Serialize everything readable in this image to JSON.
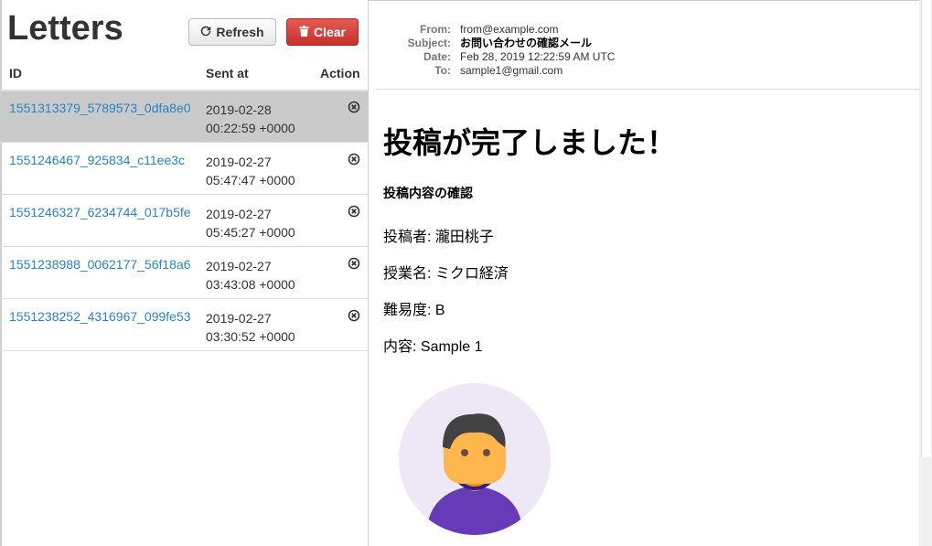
{
  "list": {
    "title": "Letters",
    "refresh_label": "Refresh",
    "clear_label": "Clear",
    "columns": [
      "ID",
      "Sent at",
      "Action"
    ],
    "rows": [
      {
        "id": "1551313379_5789573_0dfa8e0",
        "date": "2019-02-28",
        "time": "00:22:59 +0000",
        "selected": true
      },
      {
        "id": "1551246467_925834_c11ee3c",
        "date": "2019-02-27",
        "time": "05:47:47 +0000",
        "selected": false
      },
      {
        "id": "1551246327_6234744_017b5fe",
        "date": "2019-02-27",
        "time": "05:45:27 +0000",
        "selected": false
      },
      {
        "id": "1551238988_0062177_56f18a6",
        "date": "2019-02-27",
        "time": "03:43:08 +0000",
        "selected": false
      },
      {
        "id": "1551238252_4316967_099fe53",
        "date": "2019-02-27",
        "time": "03:30:52 +0000",
        "selected": false
      }
    ]
  },
  "message": {
    "from_label": "From:",
    "from": "from@example.com",
    "subject_label": "Subject:",
    "subject": "お問い合わせの確認メール",
    "date_label": "Date:",
    "date": "Feb 28, 2019 12:22:59 AM UTC",
    "to_label": "To:",
    "to": "sample1@gmail.com",
    "body": {
      "heading": "投稿が完了しました！",
      "subheading": "投稿内容の確認",
      "lines": [
        "投稿者: 瀧田桃子",
        "授業名: ミクロ経済",
        "難易度: B",
        "内容: Sample 1"
      ]
    }
  },
  "colors": {
    "link": "#2a84c2",
    "clear_button": "#d43f3a",
    "selected_row": "#cacaca",
    "avatar_bg": "#ede7f6",
    "shirt": "#673ab7"
  }
}
